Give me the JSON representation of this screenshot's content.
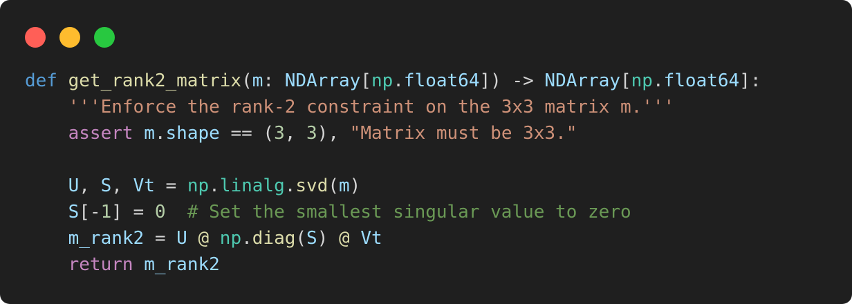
{
  "window": {
    "controls": [
      "close",
      "minimize",
      "zoom"
    ],
    "colors": {
      "background": "#1f1f1f",
      "close": "#ff5f57",
      "minimize": "#febc2e",
      "zoom": "#28c840"
    }
  },
  "code": {
    "language": "python",
    "lines": [
      "def get_rank2_matrix(m: NDArray[np.float64]) -> NDArray[np.float64]:",
      "    '''Enforce the rank-2 constraint on the 3x3 matrix m.'''",
      "    assert m.shape == (3, 3), \"Matrix must be 3x3.\"",
      "",
      "    U, S, Vt = np.linalg.svd(m)",
      "    S[-1] = 0  # Set the smallest singular value to zero",
      "    m_rank2 = U @ np.diag(S) @ Vt",
      "    return m_rank2"
    ],
    "tokens": {
      "l1": {
        "def": "def",
        "fn": "get_rank2_matrix",
        "p1": "(",
        "m": "m",
        "colon": ": ",
        "type1": "NDArray",
        "b1": "[",
        "np1": "np",
        "dot1": ".",
        "f1": "float64",
        "b2": "])",
        "arrow": " -> ",
        "type2": "NDArray",
        "b3": "[",
        "np2": "np",
        "dot2": ".",
        "f2": "float64",
        "b4": "]:"
      },
      "l2": {
        "indent": "    ",
        "doc": "'''Enforce the rank-2 constraint on the 3x3 matrix m.'''"
      },
      "l3": {
        "indent": "    ",
        "assert": "assert",
        "sp": " ",
        "m": "m",
        "dot": ".",
        "shape": "shape",
        "eq": " == (",
        "n1": "3",
        "comma": ", ",
        "n2": "3",
        "close": "), ",
        "str": "\"Matrix must be 3x3.\""
      },
      "l5": {
        "indent": "    ",
        "U": "U",
        "c1": ", ",
        "S": "S",
        "c2": ", ",
        "Vt": "Vt",
        "eq": " = ",
        "np": "np",
        "d1": ".",
        "linalg": "linalg",
        "d2": ".",
        "svd": "svd",
        "p1": "(",
        "m": "m",
        "p2": ")"
      },
      "l6": {
        "indent": "    ",
        "S": "S",
        "br": "[-",
        "n1": "1",
        "eq": "] = ",
        "n0": "0",
        "sp": "  ",
        "cmt": "# Set the smallest singular value to zero"
      },
      "l7": {
        "indent": "    ",
        "mr": "m_rank2",
        "eq": " = ",
        "U": "U",
        "at1": " @ ",
        "np": "np",
        "dot": ".",
        "diag": "diag",
        "p1": "(",
        "S": "S",
        "p2": ")",
        "at2": " @ ",
        "Vt": "Vt"
      },
      "l8": {
        "indent": "    ",
        "ret": "return",
        "sp": " ",
        "mr": "m_rank2"
      }
    }
  }
}
